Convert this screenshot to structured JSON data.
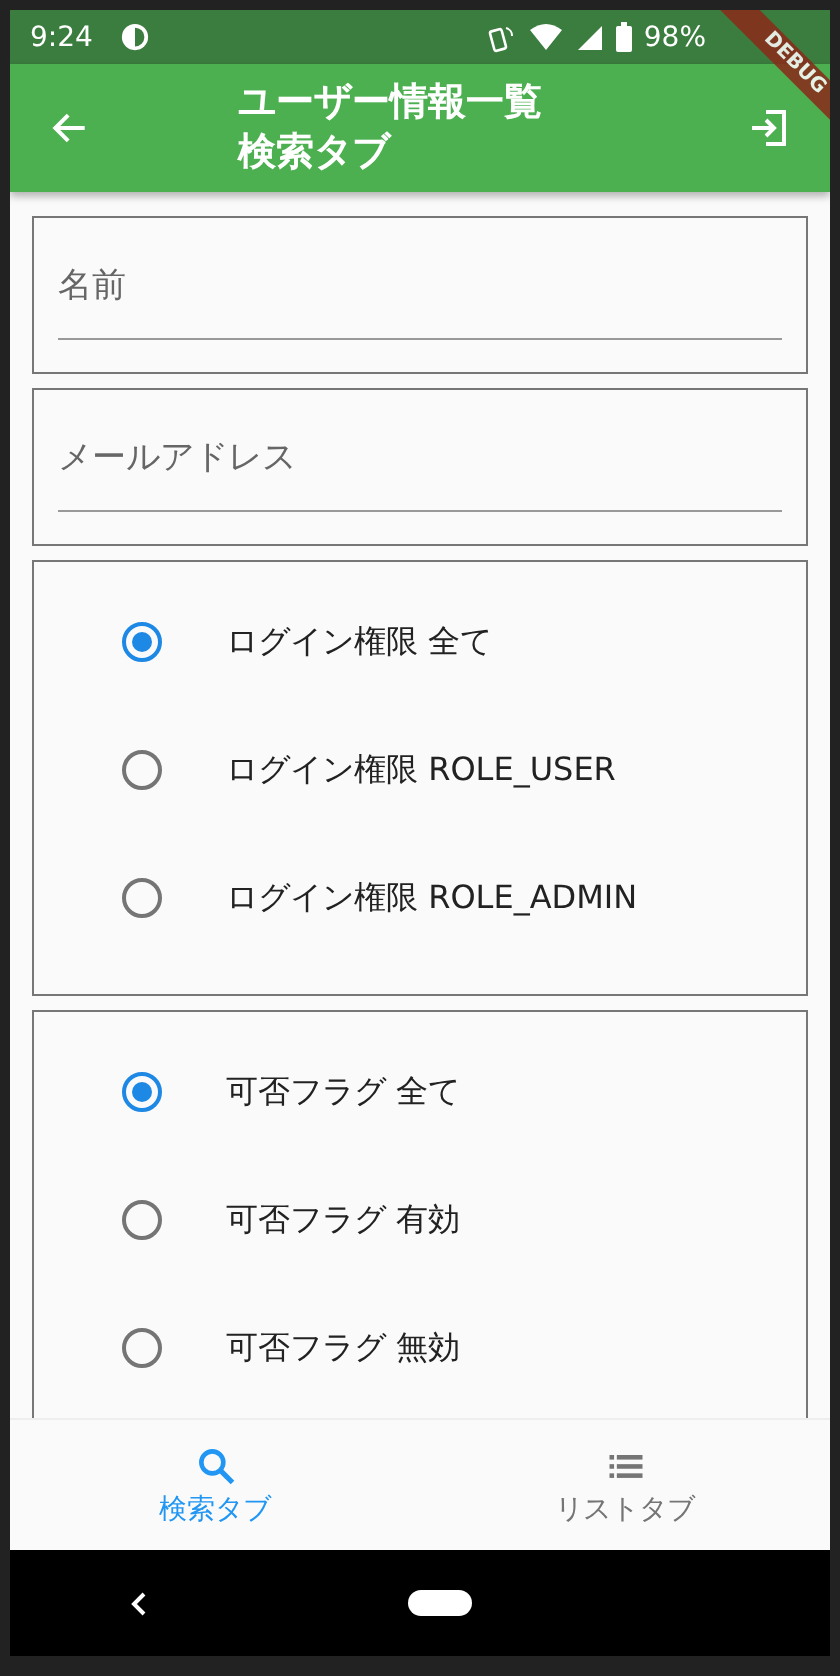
{
  "status_bar": {
    "time": "9:24",
    "battery": "98%"
  },
  "debug_banner": "DEBUG",
  "app_bar": {
    "title_lines": [
      "ユーザー情報一覧",
      "検索タブ"
    ]
  },
  "fields": [
    {
      "placeholder": "名前"
    },
    {
      "placeholder": "メールアドレス"
    }
  ],
  "radio_groups": [
    {
      "options": [
        {
          "label": "ログイン権限 全て",
          "selected": true
        },
        {
          "label": "ログイン権限 ROLE_USER",
          "selected": false
        },
        {
          "label": "ログイン権限 ROLE_ADMIN",
          "selected": false
        }
      ]
    },
    {
      "options": [
        {
          "label": "可否フラグ 全て",
          "selected": true
        },
        {
          "label": "可否フラグ 有効",
          "selected": false
        },
        {
          "label": "可否フラグ 無効",
          "selected": false
        }
      ]
    }
  ],
  "bottom_nav": [
    {
      "label": "検索タブ",
      "kind": "search",
      "selected": true
    },
    {
      "label": "リストタブ",
      "kind": "list",
      "selected": false
    }
  ]
}
